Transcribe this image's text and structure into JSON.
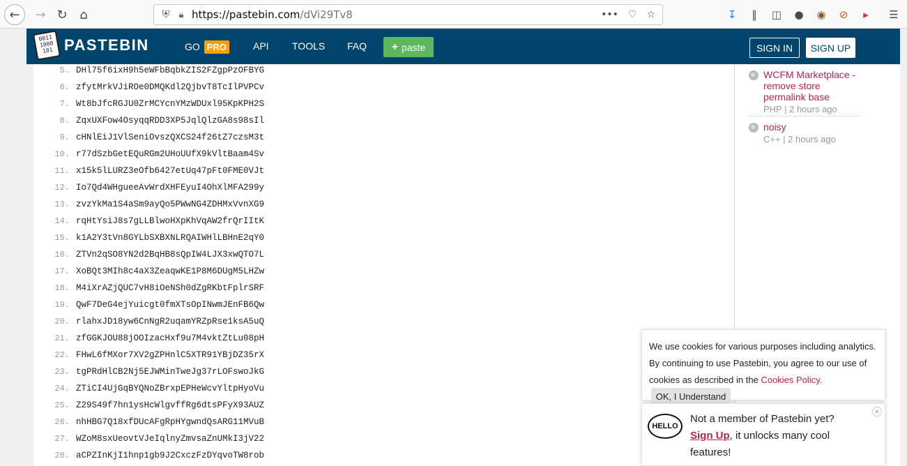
{
  "browser": {
    "url_host": "https://pastebin.com",
    "url_path": "/dVi29Tv8",
    "icons": [
      "back-icon",
      "forward-icon",
      "reload-icon",
      "home-icon",
      "shield-icon",
      "lock-icon",
      "more-icon",
      "pocket-icon",
      "star-icon",
      "download-icon",
      "library-icon",
      "sidebar-icon",
      "account-icon",
      "cookie-icon",
      "blocked-icon",
      "megaphone-icon",
      "menu-icon"
    ]
  },
  "header": {
    "logo_digits": "0011\n1000\n101",
    "logo_text": "PASTEBIN",
    "go_label": "GO",
    "pro_label": "PRO",
    "api_label": "API",
    "tools_label": "TOOLS",
    "faq_label": "FAQ",
    "paste_label": "paste",
    "signin_label": "SIGN IN",
    "signup_label": "SIGN UP",
    "brand_color": "#02456c",
    "accent_color": "#5cb85c"
  },
  "code_lines": [
    {
      "num": "5.",
      "text": "DHl75f6ixH9h5eWFbBqbkZIS2FZgpPzOFBYG"
    },
    {
      "num": "6.",
      "text": "zfytMrkVJiROe0DMQKdl2QjbvT8TcIlPVPCv"
    },
    {
      "num": "7.",
      "text": "Wt8bJfcRGJU0ZrMCYcnYMzWDUxl95KpKPH2S"
    },
    {
      "num": "8.",
      "text": "ZqxUXFow4OsyqqRDD3XP5JqlQlzGA8s98sIl"
    },
    {
      "num": "9.",
      "text": "cHNlEiJ1VlSeniOvszQXCS24f26tZ7czsM3t"
    },
    {
      "num": "10.",
      "text": "r77dSzbGetEQuRGm2UHoUUfX9kVltBaam4Sv"
    },
    {
      "num": "11.",
      "text": "x15k5lLURZ3eOfb6427etUq47pFt0FME0VJt"
    },
    {
      "num": "12.",
      "text": "Io7Qd4WHgueeAvWrdXHFEyuI4OhXlMFA299y"
    },
    {
      "num": "13.",
      "text": "zvzYkMa1S4aSm9ayQo5PWwNG4ZDHMxVvnXG9"
    },
    {
      "num": "14.",
      "text": "rqHtYsiJ8s7gLLBlwoHXpKhVqAW2frQrIItK"
    },
    {
      "num": "15.",
      "text": "k1A2Y3tVn8GYLbSXBXNLRQAIWHlLBHnE2qY0"
    },
    {
      "num": "16.",
      "text": "ZTVn2qSO8YN2d2BqHB8sQpIW4LJX3xwQTO7L"
    },
    {
      "num": "17.",
      "text": "XoBQt3MIh8c4aX3ZeaqwKE1P8M6DUgM5LHZw"
    },
    {
      "num": "18.",
      "text": "M4iXrAZjQUC7vH8iOeNSh0dZgRKbtFplrSRF"
    },
    {
      "num": "19.",
      "text": "QwF7DeG4ejYuicgt0fmXTsOpINwmJEnFB6Qw"
    },
    {
      "num": "20.",
      "text": "rlahxJD18yw6CnNgR2uqamYRZpRse1ksA5uQ"
    },
    {
      "num": "21.",
      "text": "zfGGKJOU88jOOIzacHxf9u7M4vktZtLu08pH"
    },
    {
      "num": "22.",
      "text": "FHwL6fMXor7XV2gZPHnlC5XTR91YBjDZ35rX"
    },
    {
      "num": "23.",
      "text": "tgPRdHlCB2Nj5EJWMinTweJg37rLOFswoJkG"
    },
    {
      "num": "24.",
      "text": "ZTiCI4UjGqBYQNoZBrxpEPHeWcvYltpHyoVu"
    },
    {
      "num": "25.",
      "text": "Z29S49f7hn1ysHcWlgvffRg6dtsPFyX93AUZ"
    },
    {
      "num": "26.",
      "text": "nhHBG7Q18xfDUcAFgRpHYgwndQsARG11MVuB"
    },
    {
      "num": "27.",
      "text": "WZoM8sxUeovtVJeIqlnyZmvsaZnUMkI3jV22"
    },
    {
      "num": "28.",
      "text": "aCPZInKjI1hnp1gb9J2CxczFzDYqvoTW8rob"
    }
  ],
  "sidebar": {
    "items": [
      {
        "title": "WCFM Marketplace - remove store permalink base",
        "meta": "PHP | 2 hours ago"
      },
      {
        "title": "noisy",
        "meta": "C++ | 2 hours ago"
      }
    ]
  },
  "cookie": {
    "text_before": "We use cookies for various purposes including analytics. By continuing to use Pastebin, you agree to our use of cookies as described in the ",
    "link": "Cookies Policy",
    "text_after": ".",
    "ok_label": "OK, I Understand"
  },
  "member": {
    "hello": "HELLO",
    "line1": "Not a member of Pastebin yet?",
    "signup_link": "Sign Up",
    "line2": ", it unlocks many cool features!",
    "close": "×"
  }
}
